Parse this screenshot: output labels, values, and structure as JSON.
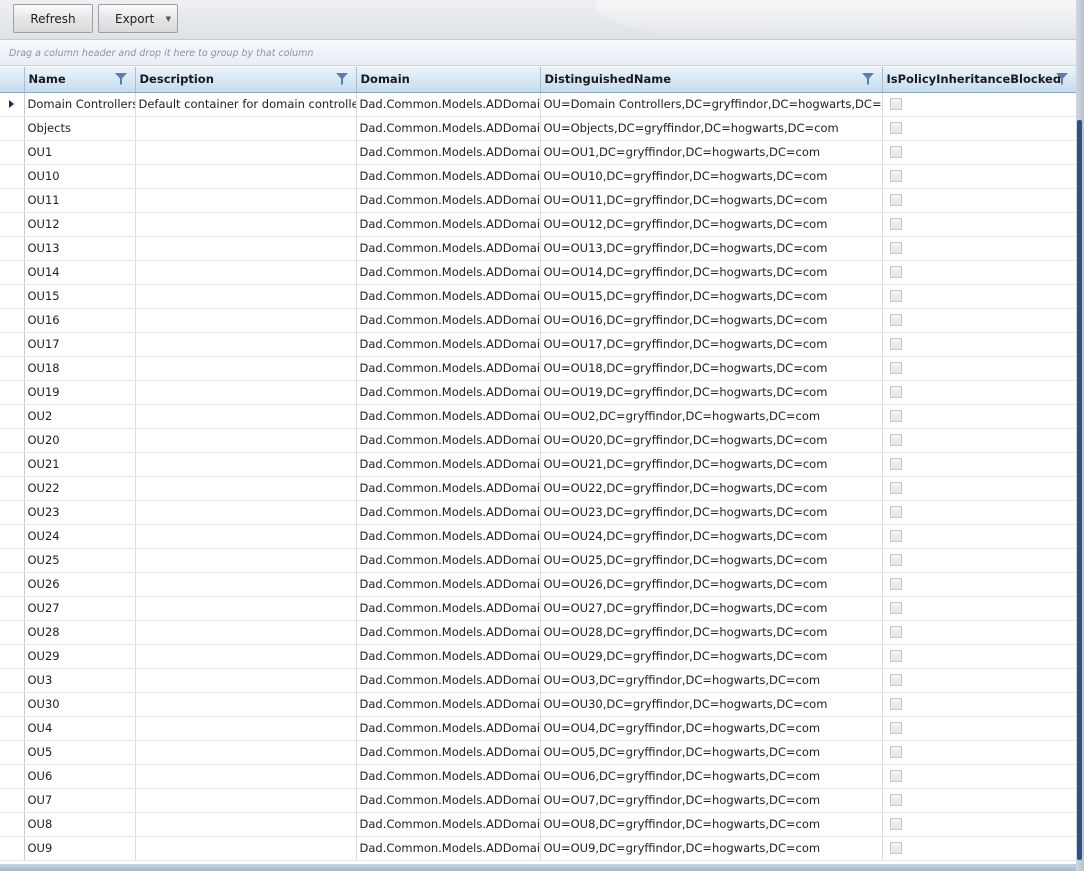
{
  "toolbar": {
    "refresh_label": "Refresh",
    "export_label": "Export"
  },
  "group_panel": {
    "hint": "Drag a column header and drop it here to group by that column"
  },
  "columns": [
    "Name",
    "Description",
    "Domain",
    "DistinguishedName",
    "IsPolicyInheritanceBlocked"
  ],
  "rows": [
    {
      "name": "Domain Controllers",
      "description": "Default container for domain controllers",
      "domain": "Dad.Common.Models.ADDomain",
      "dn": "OU=Domain Controllers,DC=gryffindor,DC=hogwarts,DC=com",
      "blocked": false,
      "current": true
    },
    {
      "name": "Objects",
      "description": "",
      "domain": "Dad.Common.Models.ADDomain",
      "dn": "OU=Objects,DC=gryffindor,DC=hogwarts,DC=com",
      "blocked": false
    },
    {
      "name": "OU1",
      "description": "",
      "domain": "Dad.Common.Models.ADDomain",
      "dn": "OU=OU1,DC=gryffindor,DC=hogwarts,DC=com",
      "blocked": false
    },
    {
      "name": "OU10",
      "description": "",
      "domain": "Dad.Common.Models.ADDomain",
      "dn": "OU=OU10,DC=gryffindor,DC=hogwarts,DC=com",
      "blocked": false
    },
    {
      "name": "OU11",
      "description": "",
      "domain": "Dad.Common.Models.ADDomain",
      "dn": "OU=OU11,DC=gryffindor,DC=hogwarts,DC=com",
      "blocked": false
    },
    {
      "name": "OU12",
      "description": "",
      "domain": "Dad.Common.Models.ADDomain",
      "dn": "OU=OU12,DC=gryffindor,DC=hogwarts,DC=com",
      "blocked": false
    },
    {
      "name": "OU13",
      "description": "",
      "domain": "Dad.Common.Models.ADDomain",
      "dn": "OU=OU13,DC=gryffindor,DC=hogwarts,DC=com",
      "blocked": false
    },
    {
      "name": "OU14",
      "description": "",
      "domain": "Dad.Common.Models.ADDomain",
      "dn": "OU=OU14,DC=gryffindor,DC=hogwarts,DC=com",
      "blocked": false
    },
    {
      "name": "OU15",
      "description": "",
      "domain": "Dad.Common.Models.ADDomain",
      "dn": "OU=OU15,DC=gryffindor,DC=hogwarts,DC=com",
      "blocked": false
    },
    {
      "name": "OU16",
      "description": "",
      "domain": "Dad.Common.Models.ADDomain",
      "dn": "OU=OU16,DC=gryffindor,DC=hogwarts,DC=com",
      "blocked": false
    },
    {
      "name": "OU17",
      "description": "",
      "domain": "Dad.Common.Models.ADDomain",
      "dn": "OU=OU17,DC=gryffindor,DC=hogwarts,DC=com",
      "blocked": false
    },
    {
      "name": "OU18",
      "description": "",
      "domain": "Dad.Common.Models.ADDomain",
      "dn": "OU=OU18,DC=gryffindor,DC=hogwarts,DC=com",
      "blocked": false
    },
    {
      "name": "OU19",
      "description": "",
      "domain": "Dad.Common.Models.ADDomain",
      "dn": "OU=OU19,DC=gryffindor,DC=hogwarts,DC=com",
      "blocked": false
    },
    {
      "name": "OU2",
      "description": "",
      "domain": "Dad.Common.Models.ADDomain",
      "dn": "OU=OU2,DC=gryffindor,DC=hogwarts,DC=com",
      "blocked": false
    },
    {
      "name": "OU20",
      "description": "",
      "domain": "Dad.Common.Models.ADDomain",
      "dn": "OU=OU20,DC=gryffindor,DC=hogwarts,DC=com",
      "blocked": false
    },
    {
      "name": "OU21",
      "description": "",
      "domain": "Dad.Common.Models.ADDomain",
      "dn": "OU=OU21,DC=gryffindor,DC=hogwarts,DC=com",
      "blocked": false
    },
    {
      "name": "OU22",
      "description": "",
      "domain": "Dad.Common.Models.ADDomain",
      "dn": "OU=OU22,DC=gryffindor,DC=hogwarts,DC=com",
      "blocked": false
    },
    {
      "name": "OU23",
      "description": "",
      "domain": "Dad.Common.Models.ADDomain",
      "dn": "OU=OU23,DC=gryffindor,DC=hogwarts,DC=com",
      "blocked": false
    },
    {
      "name": "OU24",
      "description": "",
      "domain": "Dad.Common.Models.ADDomain",
      "dn": "OU=OU24,DC=gryffindor,DC=hogwarts,DC=com",
      "blocked": false
    },
    {
      "name": "OU25",
      "description": "",
      "domain": "Dad.Common.Models.ADDomain",
      "dn": "OU=OU25,DC=gryffindor,DC=hogwarts,DC=com",
      "blocked": false
    },
    {
      "name": "OU26",
      "description": "",
      "domain": "Dad.Common.Models.ADDomain",
      "dn": "OU=OU26,DC=gryffindor,DC=hogwarts,DC=com",
      "blocked": false
    },
    {
      "name": "OU27",
      "description": "",
      "domain": "Dad.Common.Models.ADDomain",
      "dn": "OU=OU27,DC=gryffindor,DC=hogwarts,DC=com",
      "blocked": false
    },
    {
      "name": "OU28",
      "description": "",
      "domain": "Dad.Common.Models.ADDomain",
      "dn": "OU=OU28,DC=gryffindor,DC=hogwarts,DC=com",
      "blocked": false
    },
    {
      "name": "OU29",
      "description": "",
      "domain": "Dad.Common.Models.ADDomain",
      "dn": "OU=OU29,DC=gryffindor,DC=hogwarts,DC=com",
      "blocked": false
    },
    {
      "name": "OU3",
      "description": "",
      "domain": "Dad.Common.Models.ADDomain",
      "dn": "OU=OU3,DC=gryffindor,DC=hogwarts,DC=com",
      "blocked": false
    },
    {
      "name": "OU30",
      "description": "",
      "domain": "Dad.Common.Models.ADDomain",
      "dn": "OU=OU30,DC=gryffindor,DC=hogwarts,DC=com",
      "blocked": false
    },
    {
      "name": "OU4",
      "description": "",
      "domain": "Dad.Common.Models.ADDomain",
      "dn": "OU=OU4,DC=gryffindor,DC=hogwarts,DC=com",
      "blocked": false
    },
    {
      "name": "OU5",
      "description": "",
      "domain": "Dad.Common.Models.ADDomain",
      "dn": "OU=OU5,DC=gryffindor,DC=hogwarts,DC=com",
      "blocked": false
    },
    {
      "name": "OU6",
      "description": "",
      "domain": "Dad.Common.Models.ADDomain",
      "dn": "OU=OU6,DC=gryffindor,DC=hogwarts,DC=com",
      "blocked": false
    },
    {
      "name": "OU7",
      "description": "",
      "domain": "Dad.Common.Models.ADDomain",
      "dn": "OU=OU7,DC=gryffindor,DC=hogwarts,DC=com",
      "blocked": false
    },
    {
      "name": "OU8",
      "description": "",
      "domain": "Dad.Common.Models.ADDomain",
      "dn": "OU=OU8,DC=gryffindor,DC=hogwarts,DC=com",
      "blocked": false
    },
    {
      "name": "OU9",
      "description": "",
      "domain": "Dad.Common.Models.ADDomain",
      "dn": "OU=OU9,DC=gryffindor,DC=hogwarts,DC=com",
      "blocked": false
    }
  ],
  "icons": {
    "filter": "filter-funnel-icon",
    "current_row": "current-row-arrow-icon",
    "dropdown": "chevron-down-icon"
  },
  "colors": {
    "header_accent": "#c6dcef",
    "current_row_marker": "#1b2a66",
    "scrollbar_thumb": "#2f4f89"
  }
}
